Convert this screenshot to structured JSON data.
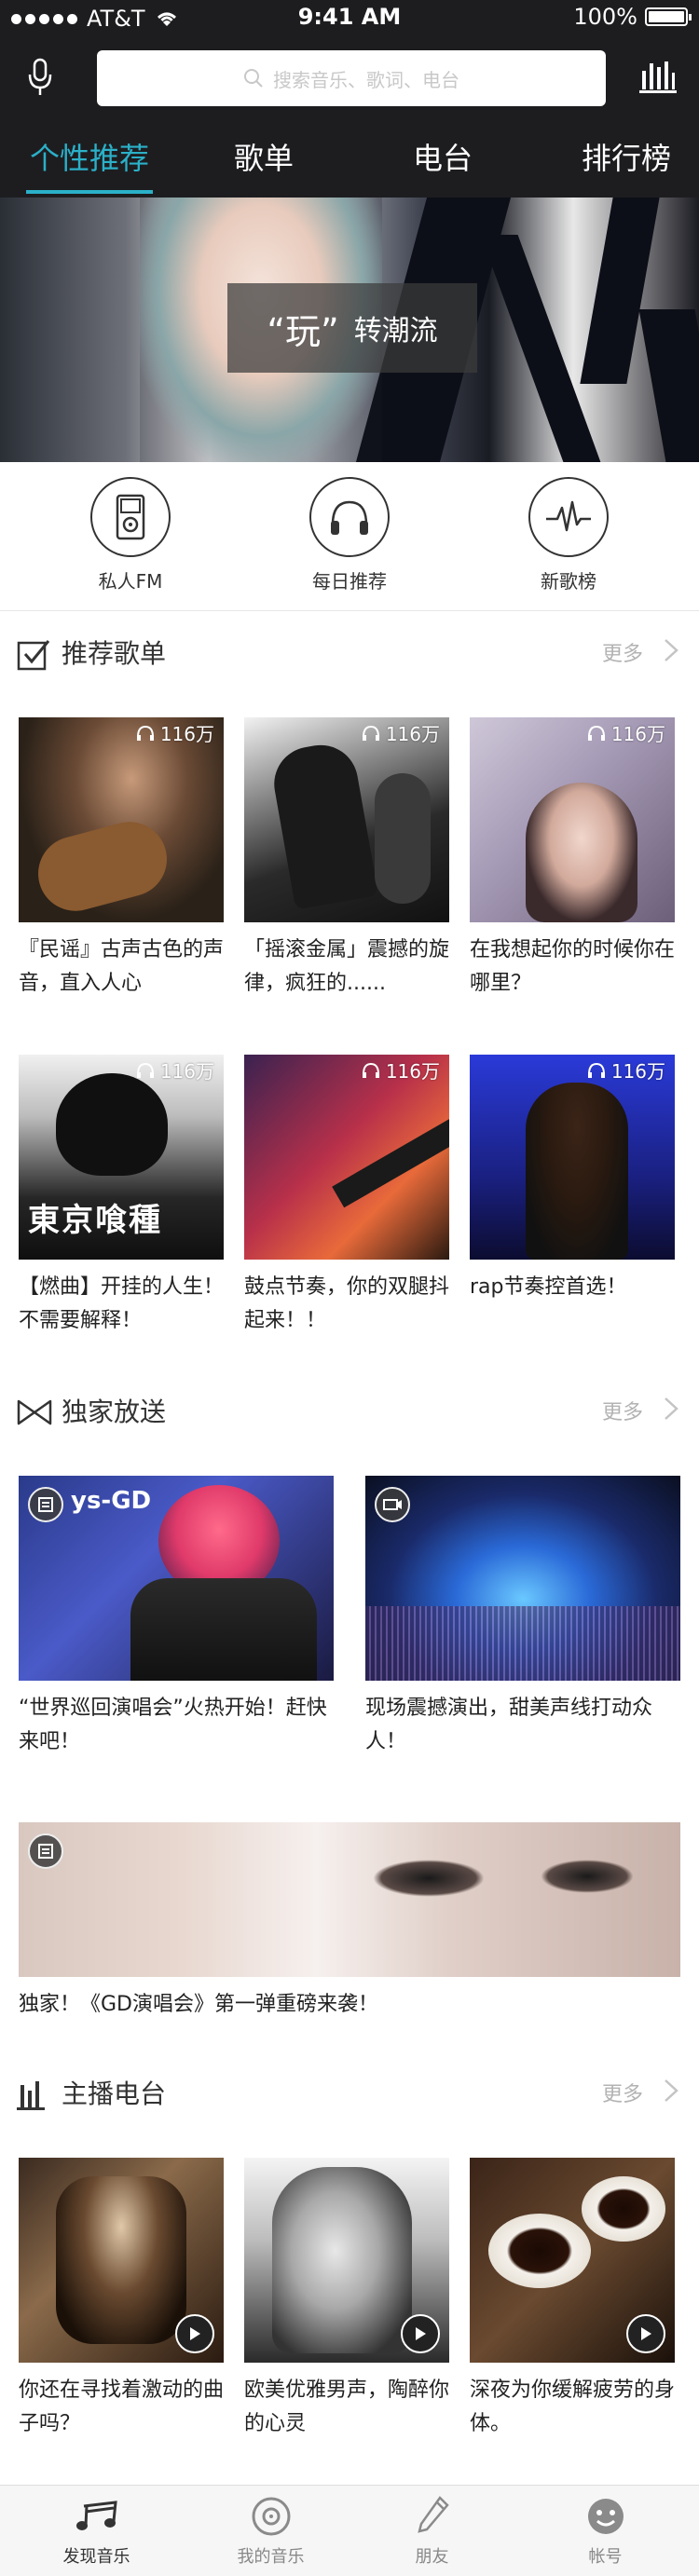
{
  "status_bar": {
    "carrier": "AT&T",
    "time": "9:41 AM",
    "battery": "100%"
  },
  "search": {
    "placeholder": "搜索音乐、歌词、电台"
  },
  "tabs": [
    {
      "label": "个性推荐",
      "active": true
    },
    {
      "label": "歌单",
      "active": false
    },
    {
      "label": "电台",
      "active": false
    },
    {
      "label": "排行榜",
      "active": false
    }
  ],
  "banner": {
    "caption_main": "“玩”",
    "caption_sub": "转潮流"
  },
  "quick_entries": [
    {
      "label": "私人FM",
      "icon": "ipod-icon"
    },
    {
      "label": "每日推荐",
      "icon": "headphones-icon"
    },
    {
      "label": "新歌榜",
      "icon": "pulse-icon"
    }
  ],
  "sections": {
    "recommended": {
      "title": "推荐歌单",
      "more": "更多",
      "items": [
        {
          "count": "116万",
          "caption": "『民谣』古声古色的声音，直入人心"
        },
        {
          "count": "116万",
          "caption": "「摇滚金属」震撼的旋律，疯狂的......"
        },
        {
          "count": "116万",
          "caption": "在我想起你的时候你在哪里？"
        },
        {
          "count": "116万",
          "caption": "【燃曲】开挂的人生！不需要解释！"
        },
        {
          "count": "116万",
          "caption": "鼓点节奏，你的双腿抖起来！！"
        },
        {
          "count": "116万",
          "caption": "rap节奏控首选！"
        }
      ]
    },
    "exclusive": {
      "title": "独家放送",
      "more": "更多",
      "items": [
        {
          "caption": "“世界巡回演唱会”火热开始！赶快来吧！",
          "badge": "list-icon",
          "image_text": "ys-GD"
        },
        {
          "caption": "现场震撼演出，甜美声线打动众人！",
          "badge": "video-icon"
        }
      ],
      "featured": {
        "caption": "独家！《GD演唱会》第一弹重磅来袭！",
        "badge": "list-icon"
      }
    },
    "radio": {
      "title": "主播电台",
      "more": "更多",
      "items": [
        {
          "caption": "你还在寻找着激动的曲子吗？"
        },
        {
          "caption": "欧美优雅男声，陶醉你的心灵"
        },
        {
          "caption": "深夜为你缓解疲劳的身体。"
        }
      ]
    }
  },
  "bottom_nav": [
    {
      "label": "发现音乐",
      "icon": "music-notes-icon",
      "active": true
    },
    {
      "label": "我的音乐",
      "icon": "disc-icon",
      "active": false
    },
    {
      "label": "朋友",
      "icon": "pen-icon",
      "active": false
    },
    {
      "label": "帐号",
      "icon": "face-icon",
      "active": false
    }
  ],
  "colors": {
    "header_bg": "#1d1d20",
    "accent": "#2bb0c8"
  }
}
